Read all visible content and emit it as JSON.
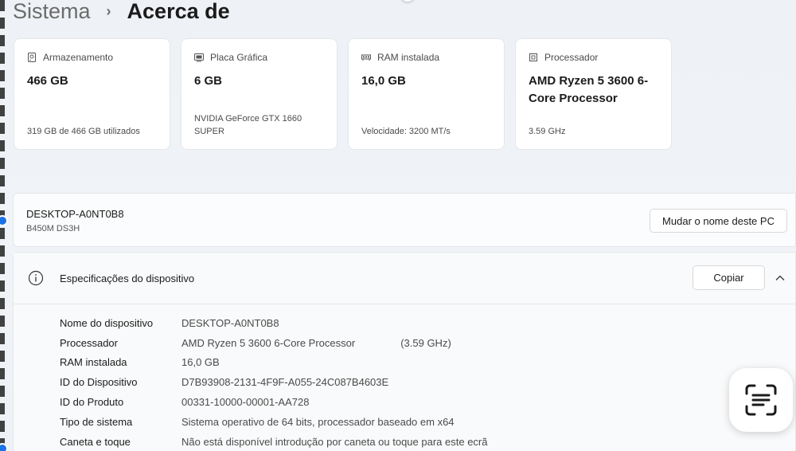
{
  "breadcrumb": {
    "parent": "Sistema",
    "separator": "›",
    "current": "Acerca de"
  },
  "cards": [
    {
      "icon": "storage-icon",
      "title": "Armazenamento",
      "value": "466 GB",
      "sub": "319 GB de 466 GB utilizados"
    },
    {
      "icon": "graphics-card-icon",
      "title": "Placa Gráfica",
      "value": "6 GB",
      "sub": "NVIDIA GeForce GTX 1660 SUPER"
    },
    {
      "icon": "ram-icon",
      "title": "RAM instalada",
      "value": "16,0 GB",
      "sub": "Velocidade: 3200 MT/s"
    },
    {
      "icon": "processor-icon",
      "title": "Processador",
      "value": "AMD Ryzen 5 3600 6-Core Processor",
      "sub": "3.59 GHz"
    }
  ],
  "device": {
    "name": "DESKTOP-A0NT0B8",
    "model": "B450M DS3H",
    "rename_label": "Mudar o nome deste PC"
  },
  "specs": {
    "title": "Especificações do dispositivo",
    "copy_label": "Copiar",
    "rows": [
      {
        "label": "Nome do dispositivo",
        "value": "DESKTOP-A0NT0B8",
        "extra": ""
      },
      {
        "label": "Processador",
        "value": "AMD Ryzen 5 3600 6-Core Processor",
        "extra": "(3.59 GHz)"
      },
      {
        "label": "RAM instalada",
        "value": "16,0 GB",
        "extra": ""
      },
      {
        "label": "ID do Dispositivo",
        "value": "D7B93908-2131-4F9F-A055-24C087B4603E",
        "extra": ""
      },
      {
        "label": "ID do Produto",
        "value": "00331-10000-00001-AA728",
        "extra": ""
      },
      {
        "label": "Tipo de sistema",
        "value": "Sistema operativo de 64 bits, processador baseado em x64",
        "extra": ""
      },
      {
        "label": "Caneta e toque",
        "value": "Não está disponível introdução por caneta ou toque para este ecrã",
        "extra": ""
      }
    ]
  },
  "colors": {
    "accent": "#1a73e8",
    "card_bg": "#ffffff",
    "page_bg": "#eef2f6"
  }
}
